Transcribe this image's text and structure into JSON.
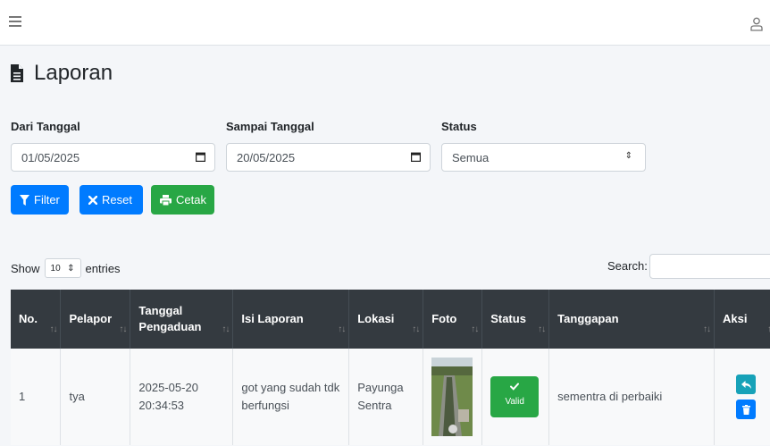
{
  "page": {
    "title": "Laporan"
  },
  "filters": {
    "from_label": "Dari Tanggal",
    "from_value": "01/05/2025",
    "to_label": "Sampai Tanggal",
    "to_value": "20/05/2025",
    "status_label": "Status",
    "status_value": "Semua"
  },
  "buttons": {
    "filter": "Filter",
    "reset": "Reset",
    "print": "Cetak"
  },
  "datatable": {
    "show_label": "Show",
    "length_value": "10",
    "entries_label": "entries",
    "search_label": "Search:"
  },
  "table": {
    "headers": [
      "No.",
      "Pelapor",
      "Tanggal Pengaduan",
      "Isi Laporan",
      "Lokasi",
      "Foto",
      "Status",
      "Tanggapan",
      "Aksi"
    ],
    "rows": [
      {
        "no": "1",
        "reporter": "tya",
        "date": "2025-05-20 20:34:53",
        "report": "got yang sudah tdk berfungsi",
        "location": "Payunga Sentra",
        "status": "Valid",
        "response": "sementra di perbaiki"
      }
    ]
  },
  "colors": {
    "primary": "#007bff",
    "success": "#28a745",
    "dark": "#343a40",
    "info": "#17a2b8"
  },
  "icons": [
    "menu-icon",
    "user-icon",
    "document-icon",
    "calendar-icon",
    "filter-icon",
    "times-icon",
    "print-icon",
    "check-icon",
    "reply-icon",
    "trash-icon"
  ]
}
